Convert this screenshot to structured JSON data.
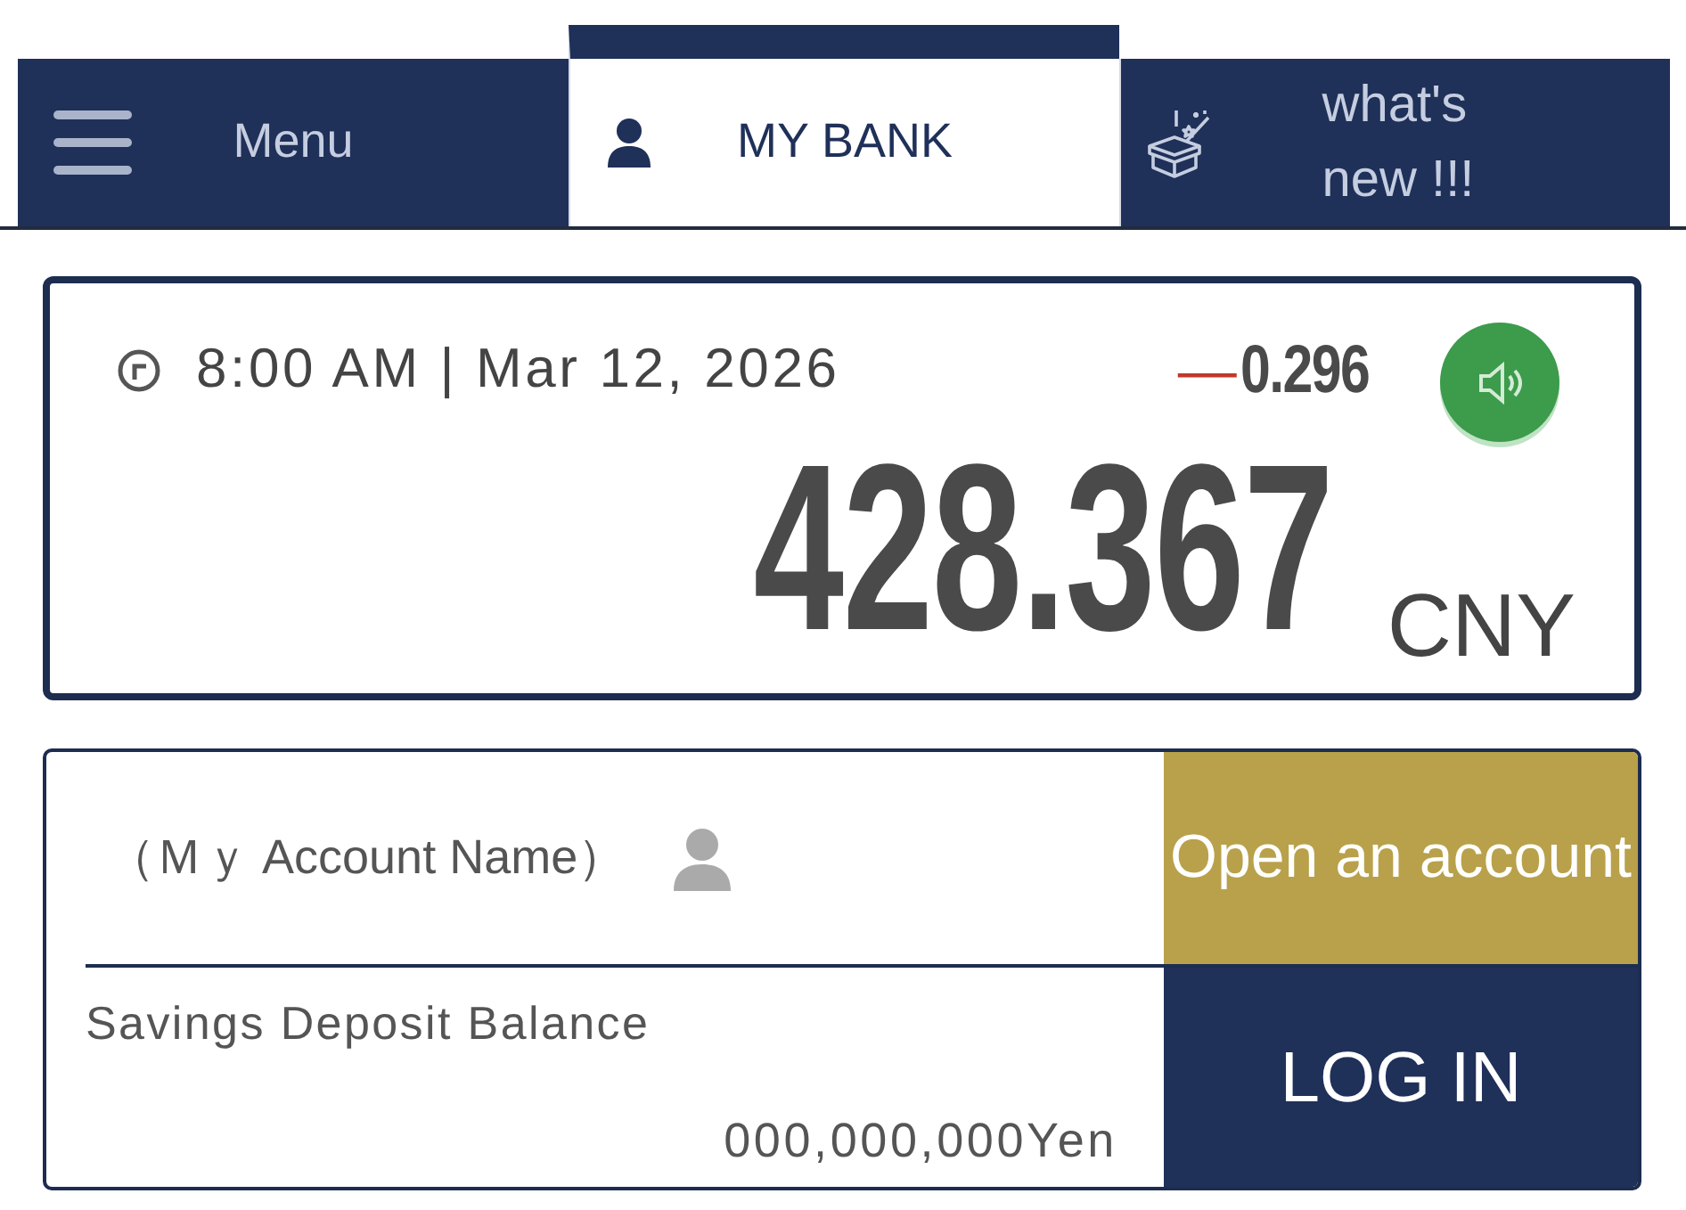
{
  "tabs": [
    {
      "kind": "menu",
      "label": "Menu",
      "selected": false
    },
    {
      "kind": "account",
      "label": "MY BANK",
      "selected": true
    },
    {
      "kind": "news",
      "label": "what's new !!!",
      "selected": false
    }
  ],
  "rate_panel": {
    "timestamp": "8:00 AM | Mar 12, 2026",
    "change_sign": "—",
    "change": "0.296",
    "value": "428.367",
    "currency": "CNY"
  },
  "account_panel": {
    "account_name": "（Ｍｙ Account Name）",
    "open_account_button": "Open an account",
    "balance_label": "Savings Deposit Balance",
    "balance": "000,000,000Yen",
    "login_button": "LOG IN"
  }
}
